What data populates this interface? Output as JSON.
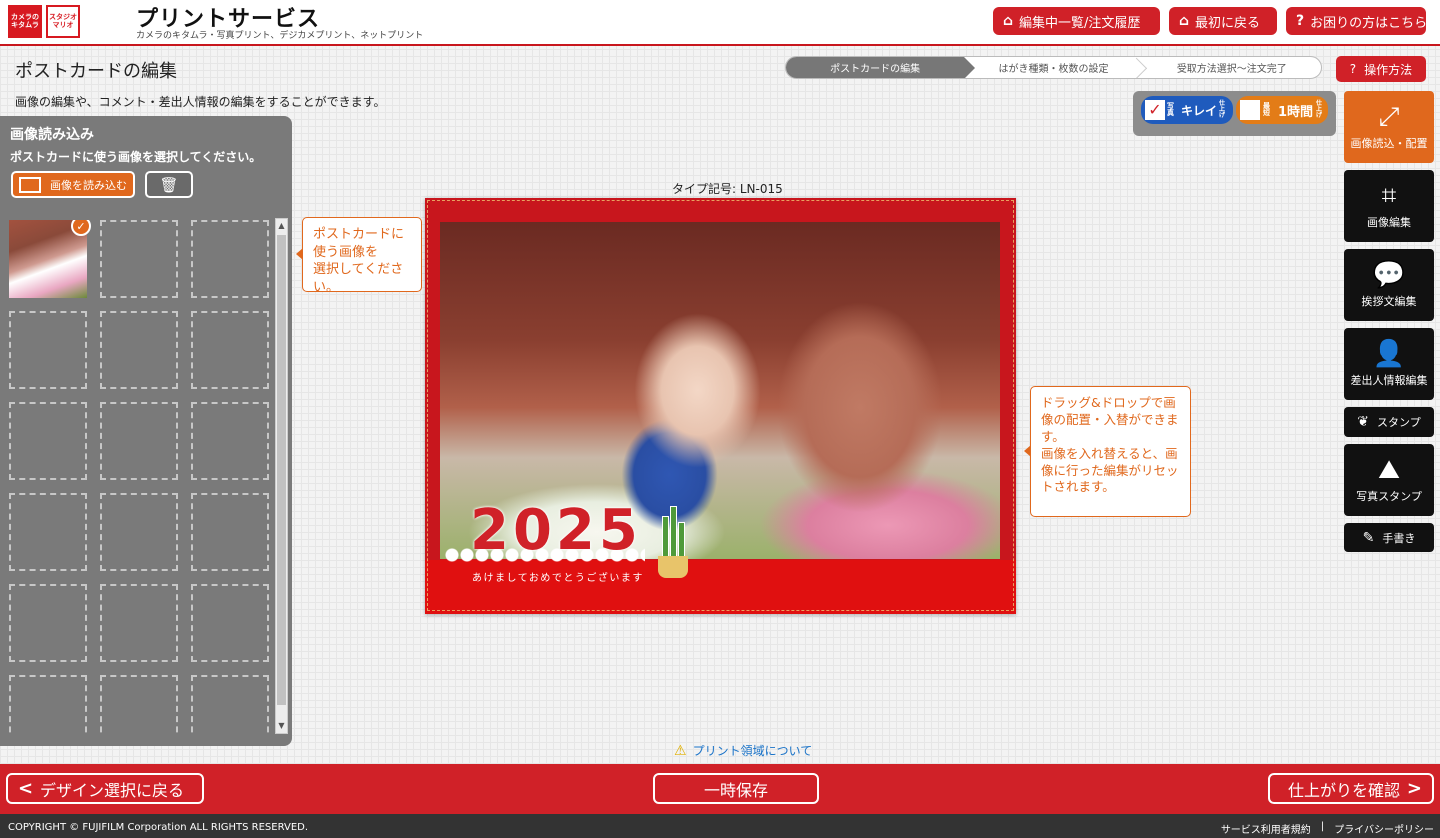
{
  "header": {
    "logo1": "カメラのキタムラ",
    "logo2": "スタジオマリオ",
    "title": "プリントサービス",
    "subtitle": "カメラのキタムラ・写真プリント、デジカメプリント、ネットプリント",
    "buttons": [
      {
        "label": "編集中一覧/注文履歴",
        "icon": "home-icon"
      },
      {
        "label": "最初に戻る",
        "icon": "home-icon"
      },
      {
        "label": "お困りの方はこちら",
        "icon": "question-icon"
      }
    ]
  },
  "page": {
    "title": "ポストカードの編集",
    "description": "画像の編集や、コメント・差出人情報の編集をすることができます。",
    "steps": [
      "ポストカードの編集",
      "はがき種類・枚数の設定",
      "受取方法選択〜注文完了"
    ],
    "active_step": 0,
    "help_label": "操作方法"
  },
  "left_panel": {
    "title": "画像読み込み",
    "description": "ポストカードに使う画像を選択してください。",
    "load_label": "画像を読み込む",
    "trash_icon": "trash-icon",
    "check_glyph": "✓"
  },
  "tooltips": {
    "select_image": "ポストカードに\n使う画像を\n選択してください。",
    "drag_drop": "ドラッグ&ドロップで画像の配置・入替ができます。\n画像を入れ替えると、画像に行った編集がリセットされます。"
  },
  "postcard": {
    "type_label": "タイプ記号: LN-015",
    "year": "2025",
    "greeting": "あけましておめでとうございます"
  },
  "print_area_link": "プリント領域について",
  "badges": {
    "badge1_small": "写真",
    "badge1": "キレイ",
    "badge1_tail": "仕上げ",
    "badge2_small": "最短",
    "badge2": "1時間",
    "badge2_tail": "仕上げ"
  },
  "toolbar": [
    {
      "label": "画像読込・配置",
      "icon": "image-load-icon",
      "glyph": "⤢"
    },
    {
      "label": "画像編集",
      "icon": "crop-icon",
      "glyph": "⌗"
    },
    {
      "label": "挨拶文編集",
      "icon": "speech-bubble-icon",
      "glyph": "💬"
    },
    {
      "label": "差出人情報編集",
      "icon": "person-icon",
      "glyph": "👤"
    },
    {
      "label": "スタンプ",
      "icon": "stamp-icon",
      "glyph": "❦"
    },
    {
      "label": "写真スタンプ",
      "icon": "photo-stamp-icon",
      "glyph": "⛰"
    },
    {
      "label": "手書き",
      "icon": "pen-icon",
      "glyph": "✎"
    }
  ],
  "footer": {
    "back_label": "デザイン選択に戻る",
    "save_label": "一時保存",
    "confirm_label": "仕上がりを確認",
    "copyright": "COPYRIGHT © FUJIFILM Corporation ALL RIGHTS RESERVED.",
    "terms": "サービス利用者規約",
    "separator": "|",
    "privacy": "プライバシーポリシー"
  },
  "colors": {
    "brand_red": "#d02128",
    "accent_orange": "#e0681d"
  }
}
